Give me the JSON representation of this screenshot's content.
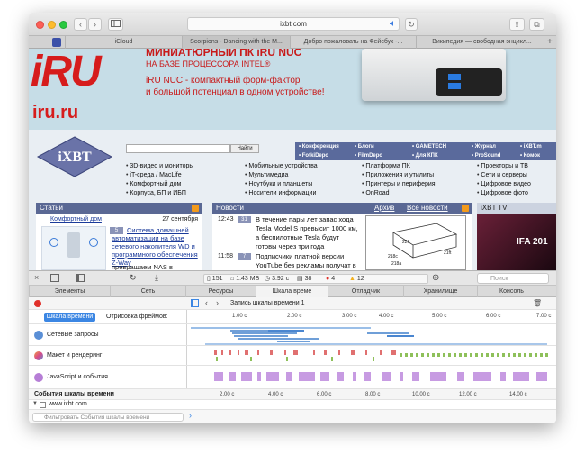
{
  "window": {
    "url": "ixbt.com",
    "nav_back": "‹",
    "nav_forward": "›"
  },
  "tabs": [
    {
      "label": "iCloud"
    },
    {
      "label": "Scorpions - Dancing with the M..."
    },
    {
      "label": "Добро пожаловать на Фейсбук -..."
    },
    {
      "label": "Википедия — свободная энцикл..."
    }
  ],
  "banner": {
    "line1": "МИНИАТЮРНЫЙ ПК iRU NUC",
    "line2": "НА БАЗЕ ПРОЦЕССОРА INTEL®",
    "line3": "iRU NUC - компактный форм-фактор",
    "line4": "и большой потенциал в одном устройстве!",
    "logo": "iRU",
    "site": "iru.ru"
  },
  "site_nav": {
    "search_button": "Найти",
    "row1": [
      "• Конференция",
      "• Блоги",
      "• GAMETECH",
      "• Журнал",
      "• iXBT.m"
    ],
    "row2": [
      "• FotkiDepo",
      "• FilmDepo",
      "• Для КПК",
      "• ProSound",
      "• Комок"
    ],
    "col1": [
      "3D-видео и мониторы",
      "iT-среда / MacLife",
      "Комфортный дом",
      "Корпуса, БП и ИБП"
    ],
    "col2": [
      "Мобильные устройства",
      "Мультимедиа",
      "Ноутбуки и планшеты",
      "Носители информации"
    ],
    "col3": [
      "Платформа ПК",
      "Приложения и утилиты",
      "Принтеры и периферия",
      "OnRoad"
    ],
    "col4": [
      "Проекторы и ТВ",
      "Сети и серверы",
      "Цифровое видео",
      "Цифровое фото"
    ]
  },
  "articles": {
    "title": "Статьи",
    "category": "Комфортный дом",
    "date": "27 сентября",
    "badge": "5",
    "text": "Система домашней автоматизации на базе сетевого накопителя WD и программного обеспечения Z-Way",
    "more": "превращаем NAS в"
  },
  "news": {
    "title": "Новости",
    "archive": "Архив",
    "all": "Все новости",
    "items": [
      {
        "time": "12:43",
        "badge": "31",
        "text": "В течение пары лет запас хода Tesla Model S превысит 1000 км, а беспилотные Tesla будут готовы через три года"
      },
      {
        "time": "11:58",
        "badge": "7",
        "text": "Подписчики платной версии YouTube без рекламы получат в подарок доступ к сервису"
      }
    ],
    "figure_labels": [
      "220",
      "21ft",
      "218c",
      "218a"
    ]
  },
  "ixbt_tv": {
    "title": "iXBT TV",
    "overlay": "IFA 201"
  },
  "inspector_toolbar": {
    "resources": "151",
    "size": "1.43 МБ",
    "time": "3.92 с",
    "logs": "38",
    "errors": "4",
    "warnings": "12",
    "search_placeholder": "Поиск"
  },
  "inspector_tabs": [
    "Элементы",
    "Сеть",
    "Ресурсы",
    "Шкала време",
    "Отладчик",
    "Хранилище",
    "Консоль"
  ],
  "timeline": {
    "recording_title": "Запись шкалы времени 1",
    "mode_active": "Шкала времени",
    "mode_frames": "Отрисовка фреймов:",
    "top_ticks": [
      "1.00 с",
      "2.00 с",
      "3.00 с",
      "4.00 с",
      "5.00 с",
      "6.00 с",
      "7.00 с"
    ],
    "lanes": [
      {
        "label": "Сетевые запросы",
        "color": "#6f9fd8"
      },
      {
        "label": "Макет и рендеринг",
        "color": "#e07070"
      },
      {
        "label": "JavaScript и события",
        "color": "#b67ed6"
      }
    ],
    "events_header": "События шкалы времени",
    "bottom_ticks": [
      "2.00 с",
      "4.00 с",
      "6.00 с",
      "8.00 с",
      "10.00 с",
      "12.00 с",
      "14.00 с"
    ],
    "tree_item": "www.ixbt.com",
    "filter_placeholder": "Фильтровать События шкалы времени"
  }
}
